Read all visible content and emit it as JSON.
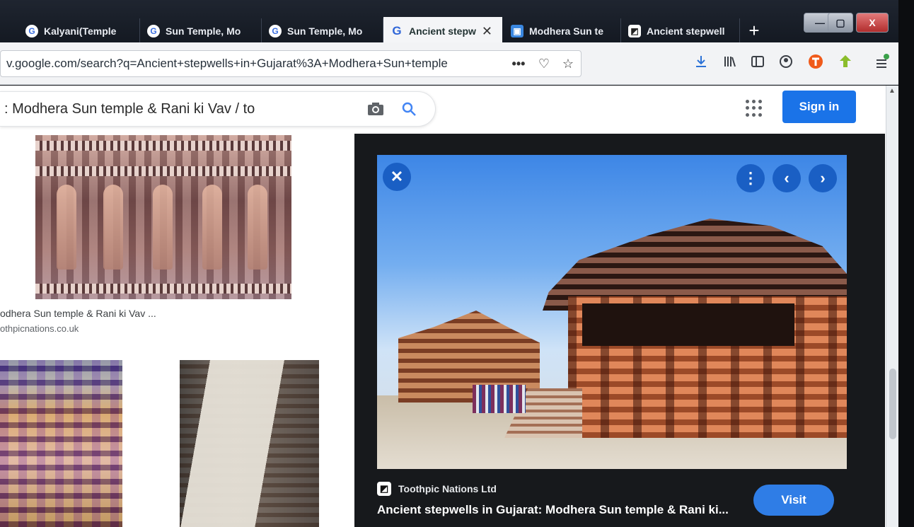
{
  "tabs": [
    {
      "label": "Kalyani(Temple",
      "icon": "google-icon",
      "glyph": "G"
    },
    {
      "label": "Sun Temple, Mo",
      "icon": "google-icon",
      "glyph": "G"
    },
    {
      "label": "Sun Temple, Mo",
      "icon": "google-icon",
      "glyph": "G"
    },
    {
      "label": "Ancient stepw",
      "icon": "google-icon",
      "glyph": "G",
      "active": true
    },
    {
      "label": "Modhera Sun te",
      "icon": "site-icon",
      "glyph": "▣"
    },
    {
      "label": "Ancient stepwell",
      "icon": "toothpic-icon",
      "glyph": "◩"
    }
  ],
  "tab_close_glyph": "✕",
  "new_tab_glyph": "+",
  "window": {
    "minimize": "—",
    "maximize": "▢",
    "close": "X"
  },
  "url": "v.google.com/search?q=Ancient+stepwells+in+Gujarat%3A+Modhera+Sun+temple",
  "url_icons": {
    "more": "•••",
    "pocket": "♡",
    "bookmark": "☆"
  },
  "toolbar_icons": [
    "download-icon",
    "library-icon",
    "sidebar-icon",
    "account-icon",
    "extension-icon",
    "leaf-extension-icon",
    "menu-icon"
  ],
  "search": {
    "query": ": Modhera Sun temple & Rani ki Vav / to"
  },
  "header": {
    "sign_in": "Sign in"
  },
  "results": [
    {
      "caption": "odhera Sun temple & Rani ki Vav ...",
      "source": "othpicnations.co.uk"
    }
  ],
  "preview": {
    "source": "Toothpic Nations Ltd",
    "title": "Ancient stepwells in Gujarat: Modhera Sun temple & Rani ki...",
    "visit": "Visit",
    "close_glyph": "✕",
    "more_glyph": "⋮",
    "prev_glyph": "‹",
    "next_glyph": "›",
    "source_glyph": "◩"
  },
  "colors": {
    "accent": "#1a73e8",
    "preview_bg": "#17191c",
    "tabbar": "#1f2530"
  }
}
